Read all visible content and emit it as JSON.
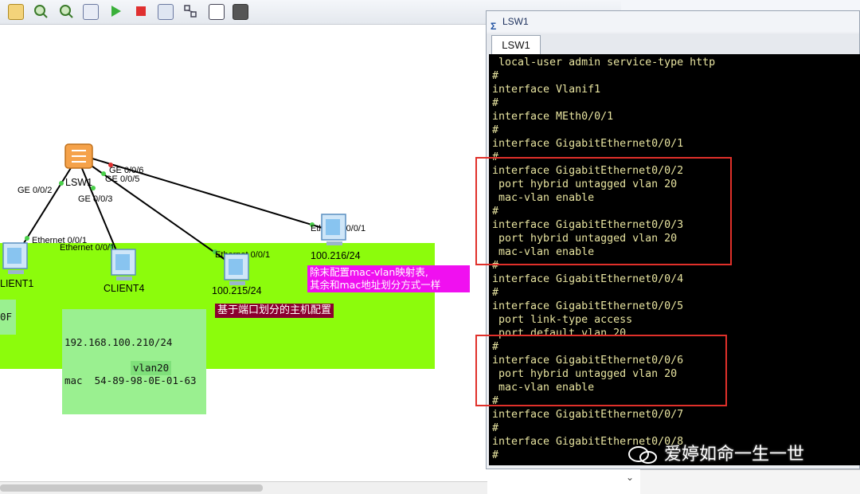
{
  "colors": {
    "vlan_area": "#8cfc0c",
    "terminal_bg": "#000000",
    "terminal_fg": "#e8e4a0",
    "highlight_box": "#e0302a",
    "magenta_note": "#f010f0",
    "maroon_note": "#8b0030"
  },
  "toolbar": {
    "icons": [
      "square-icon",
      "zoom-in-icon",
      "zoom-out-icon",
      "fit-icon",
      "start-icon",
      "stop-icon",
      "capture-icon",
      "topology-icon",
      "window-icon",
      "screenshot-icon"
    ]
  },
  "topology": {
    "switch": {
      "name": "LSW1"
    },
    "links": [
      {
        "port": "GE 0/0/2",
        "peer_port": "Ethernet 0/0/1"
      },
      {
        "port": "GE 0/0/3",
        "peer_port": "Ethernet 0/0/1"
      },
      {
        "port": "GE 0/0/5",
        "peer_port": "Ethernet 0/0/1"
      },
      {
        "port": "GE 0/0/6",
        "peer_port": "Ethernet 0/0/1"
      }
    ],
    "hosts": [
      {
        "name": "LIENT1"
      },
      {
        "name": "CLIENT4"
      },
      {
        "name": "100.215/24"
      },
      {
        "name": "100.216/24"
      }
    ],
    "left_partial": "0F",
    "mac_info": {
      "ip": "192.168.100.210/24",
      "mac": "mac  54-89-98-0E-01-63"
    },
    "notes": {
      "magenta": "除末配置mac-vlan映射表,\n其余和mac地址划分方式一样",
      "maroon": "基于端口划分的主机配置",
      "vlan": "vlan20"
    }
  },
  "window": {
    "title": "LSW1",
    "tab": "LSW1"
  },
  "terminal": {
    "lines": [
      " local-user admin service-type http",
      "#",
      "interface Vlanif1",
      "#",
      "interface MEth0/0/1",
      "#",
      "interface GigabitEthernet0/0/1",
      "#",
      "interface GigabitEthernet0/0/2",
      " port hybrid untagged vlan 20",
      " mac-vlan enable",
      "#",
      "interface GigabitEthernet0/0/3",
      " port hybrid untagged vlan 20",
      " mac-vlan enable",
      "#",
      "interface GigabitEthernet0/0/4",
      "#",
      "interface GigabitEthernet0/0/5",
      " port link-type access",
      " port default vlan 20",
      "#",
      "interface GigabitEthernet0/0/6",
      " port hybrid untagged vlan 20",
      " mac-vlan enable",
      "#",
      "interface GigabitEthernet0/0/7",
      "#",
      "interface GigabitEthernet0/0/8",
      "#"
    ]
  },
  "watermark": "爱婷如命一生一世"
}
